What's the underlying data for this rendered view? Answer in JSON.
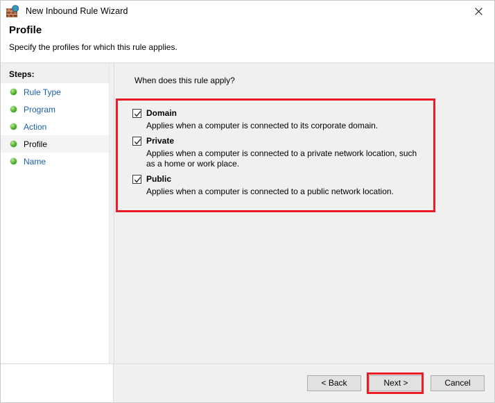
{
  "window": {
    "title": "New Inbound Rule Wizard",
    "icon": "firewall-icon",
    "close_label": "×"
  },
  "header": {
    "title": "Profile",
    "subtitle": "Specify the profiles for which this rule applies."
  },
  "sidebar": {
    "header": "Steps:",
    "items": [
      {
        "label": "Rule Type",
        "current": false
      },
      {
        "label": "Program",
        "current": false
      },
      {
        "label": "Action",
        "current": false
      },
      {
        "label": "Profile",
        "current": true
      },
      {
        "label": "Name",
        "current": false
      }
    ]
  },
  "main": {
    "question": "When does this rule apply?",
    "profiles": [
      {
        "name": "Domain",
        "checked": true,
        "description": "Applies when a computer is connected to its corporate domain."
      },
      {
        "name": "Private",
        "checked": true,
        "description": "Applies when a computer is connected to a private network location, such as a home or work place."
      },
      {
        "name": "Public",
        "checked": true,
        "description": "Applies when a computer is connected to a public network location."
      }
    ]
  },
  "footer": {
    "back_label": "< Back",
    "next_label": "Next >",
    "cancel_label": "Cancel"
  },
  "annotations": {
    "highlight_color": "#ed1c24",
    "targets": [
      "profiles-group",
      "next-button"
    ]
  },
  "colors": {
    "link": "#1a5ea8",
    "panel_background": "#f0f0f0",
    "sidebar_background": "#ffffff",
    "bullet_green": "#6cc644"
  }
}
